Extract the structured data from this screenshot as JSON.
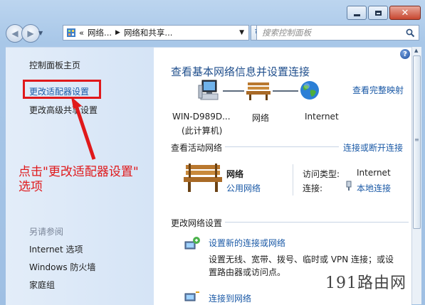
{
  "address_bar": {
    "segments": [
      "«",
      "网络...",
      "网络和共享..."
    ],
    "search_placeholder": "搜索控制面板"
  },
  "sidebar": {
    "home": "控制面板主页",
    "change_adapter": "更改适配器设置",
    "change_sharing": "更改高级共享设置",
    "see_also": "另请参阅",
    "see_also_items": [
      "Internet 选项",
      "Windows 防火墙",
      "家庭组"
    ]
  },
  "main": {
    "title": "查看基本网络信息并设置连接",
    "full_map": "查看完整映射",
    "map": {
      "computer_name": "WIN-D989D...",
      "computer_sub": "(此计算机)",
      "network": "网络",
      "internet": "Internet"
    },
    "active_networks_heading": "查看活动网络",
    "connect_disconnect": "连接或断开连接",
    "active": {
      "name": "网络",
      "type": "公用网络",
      "access_label": "访问类型:",
      "access_value": "Internet",
      "conn_label": "连接:",
      "conn_value": "本地连接"
    },
    "change_settings_heading": "更改网络设置",
    "tasks": [
      {
        "title": "设置新的连接或网络",
        "desc1": "设置无线、宽带、拨号、临时或 VPN 连接；或设",
        "desc2": "置路由器或访问点。"
      },
      {
        "title": "连接到网络"
      }
    ]
  },
  "annotation": {
    "line1": "点击\"更改适配器设置\"",
    "line2": "选项"
  },
  "watermark": "191路由网",
  "colors": {
    "annotation_red": "#e0191b",
    "link_blue": "#1a59a6",
    "title_blue": "#1f4e8c"
  }
}
